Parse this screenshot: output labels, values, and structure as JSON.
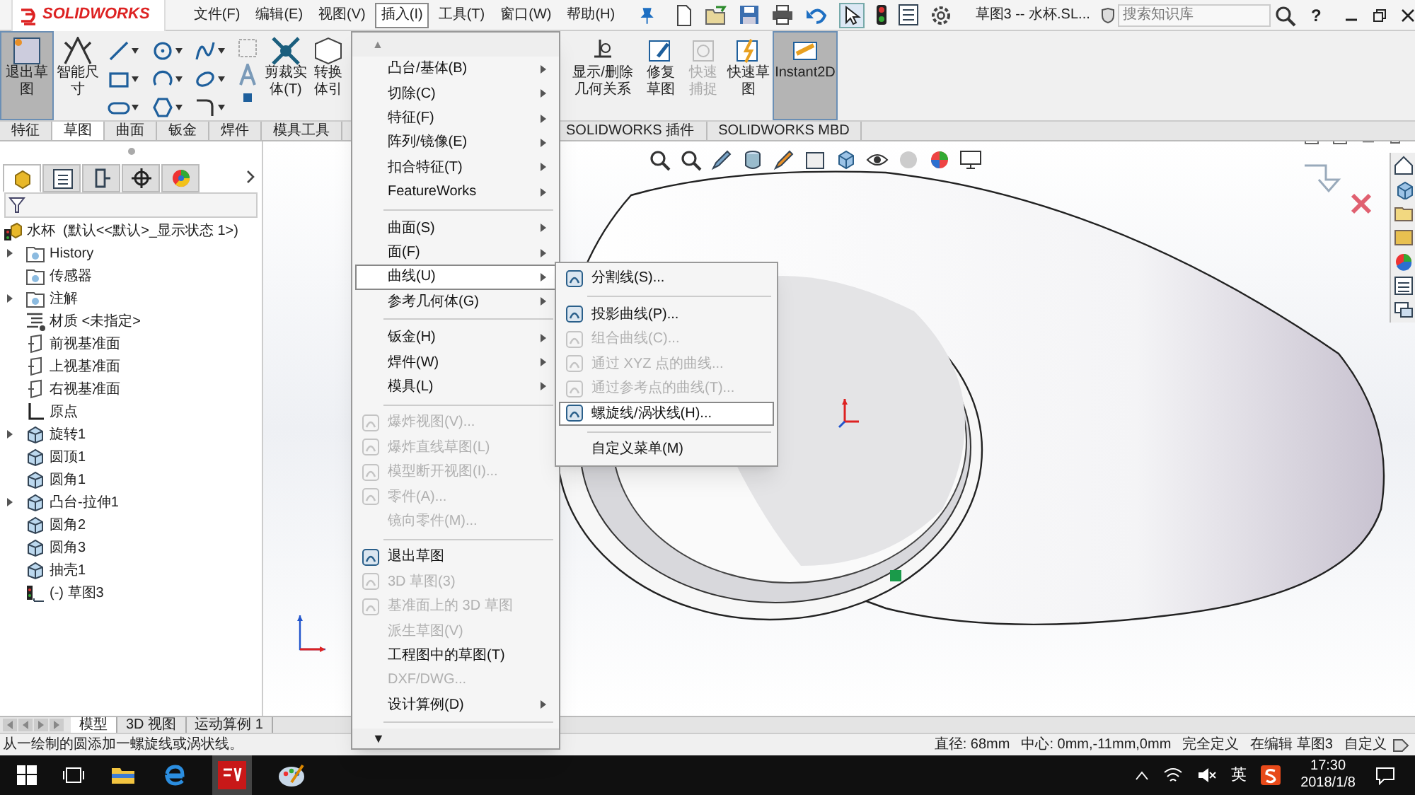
{
  "app": {
    "logo": "SOLIDWORKS",
    "title": "草图3 -- 水杯.SL..."
  },
  "menubar": [
    {
      "label": "文件(F)",
      "selected": false
    },
    {
      "label": "编辑(E)",
      "selected": false
    },
    {
      "label": "视图(V)",
      "selected": false
    },
    {
      "label": "插入(I)",
      "selected": true
    },
    {
      "label": "工具(T)",
      "selected": false
    },
    {
      "label": "窗口(W)",
      "selected": false
    },
    {
      "label": "帮助(H)",
      "selected": false
    }
  ],
  "search": {
    "placeholder": "搜索知识库"
  },
  "help": "?",
  "ribbon_left": [
    {
      "label": "退出草图",
      "selected": true,
      "disabled": false
    },
    {
      "label": "智能尺寸",
      "selected": false,
      "disabled": false
    },
    {
      "label": "剪裁实体(T)",
      "selected": false,
      "disabled": false
    },
    {
      "label": "转换体引",
      "selected": false,
      "disabled": false
    }
  ],
  "ribbon_right": [
    {
      "label": "显示/删除几何关系",
      "selected": false,
      "disabled": false
    },
    {
      "label": "修复草图",
      "selected": false,
      "disabled": false
    },
    {
      "label": "快速捕捉",
      "selected": false,
      "disabled": true
    },
    {
      "label": "快速草图",
      "selected": false,
      "disabled": false
    },
    {
      "label": "Instant2D",
      "selected": true,
      "disabled": false
    }
  ],
  "command_tabs_left": [
    {
      "label": "特征",
      "selected": false
    },
    {
      "label": "草图",
      "selected": true
    },
    {
      "label": "曲面",
      "selected": false
    },
    {
      "label": "钣金",
      "selected": false
    },
    {
      "label": "焊件",
      "selected": false
    },
    {
      "label": "模具工具",
      "selected": false
    }
  ],
  "command_tabs_right": [
    {
      "label": "SOLIDWORKS 插件",
      "selected": false
    },
    {
      "label": "SOLIDWORKS MBD",
      "selected": false
    }
  ],
  "panel_tabs": [
    {
      "selected": true
    },
    {
      "selected": false
    },
    {
      "selected": false
    },
    {
      "selected": false
    },
    {
      "selected": false
    }
  ],
  "tree": {
    "root": "水杯  (默认<<默认>_显示状态 1>)",
    "items": [
      {
        "label": "History",
        "kind": "folder",
        "expandable": true
      },
      {
        "label": "传感器",
        "kind": "folder",
        "expandable": false
      },
      {
        "label": "注解",
        "kind": "folder",
        "expandable": true
      },
      {
        "label": "材质 <未指定>",
        "kind": "material",
        "expandable": false
      },
      {
        "label": "前视基准面",
        "kind": "plane",
        "expandable": false
      },
      {
        "label": "上视基准面",
        "kind": "plane",
        "expandable": false
      },
      {
        "label": "右视基准面",
        "kind": "plane",
        "expandable": false
      },
      {
        "label": "原点",
        "kind": "origin",
        "expandable": false
      },
      {
        "label": "旋转1",
        "kind": "feature",
        "expandable": true
      },
      {
        "label": "圆顶1",
        "kind": "feature",
        "expandable": false
      },
      {
        "label": "圆角1",
        "kind": "feature",
        "expandable": false
      },
      {
        "label": "凸台-拉伸1",
        "kind": "feature",
        "expandable": true
      },
      {
        "label": "圆角2",
        "kind": "feature",
        "expandable": false
      },
      {
        "label": "圆角3",
        "kind": "feature",
        "expandable": false
      },
      {
        "label": "抽壳1",
        "kind": "feature",
        "expandable": false
      },
      {
        "label": "(-) 草图3",
        "kind": "sketch",
        "expandable": false
      }
    ]
  },
  "menu": {
    "scroll_up": "▲",
    "scroll_down": "▼",
    "items": [
      {
        "kind": "item",
        "label": "凸台/基体(B)",
        "submenu": true,
        "disabled": false,
        "selected": false
      },
      {
        "kind": "item",
        "label": "切除(C)",
        "submenu": true,
        "disabled": false,
        "selected": false
      },
      {
        "kind": "item",
        "label": "特征(F)",
        "submenu": true,
        "disabled": false,
        "selected": false
      },
      {
        "kind": "item",
        "label": "阵列/镜像(E)",
        "submenu": true,
        "disabled": false,
        "selected": false
      },
      {
        "kind": "item",
        "label": "扣合特征(T)",
        "submenu": true,
        "disabled": false,
        "selected": false
      },
      {
        "kind": "item",
        "label": "FeatureWorks",
        "submenu": true,
        "disabled": false,
        "selected": false
      },
      {
        "kind": "separator"
      },
      {
        "kind": "item",
        "label": "曲面(S)",
        "submenu": true,
        "disabled": false,
        "selected": false
      },
      {
        "kind": "item",
        "label": "面(F)",
        "submenu": true,
        "disabled": false,
        "selected": false
      },
      {
        "kind": "item",
        "label": "曲线(U)",
        "submenu": true,
        "disabled": false,
        "selected": true
      },
      {
        "kind": "item",
        "label": "参考几何体(G)",
        "submenu": true,
        "disabled": false,
        "selected": false
      },
      {
        "kind": "separator"
      },
      {
        "kind": "item",
        "label": "钣金(H)",
        "submenu": true,
        "disabled": false,
        "selected": false
      },
      {
        "kind": "item",
        "label": "焊件(W)",
        "submenu": true,
        "disabled": false,
        "selected": false
      },
      {
        "kind": "item",
        "label": "模具(L)",
        "submenu": true,
        "disabled": false,
        "selected": false
      },
      {
        "kind": "separator"
      },
      {
        "kind": "icon_item",
        "label": "爆炸视图(V)...",
        "submenu": false,
        "disabled": true,
        "selected": false
      },
      {
        "kind": "icon_item",
        "label": "爆炸直线草图(L)",
        "submenu": false,
        "disabled": true,
        "selected": false
      },
      {
        "kind": "icon_item",
        "label": "模型断开视图(I)...",
        "submenu": false,
        "disabled": true,
        "selected": false
      },
      {
        "kind": "icon_item",
        "label": "零件(A)...",
        "submenu": false,
        "disabled": true,
        "selected": false
      },
      {
        "kind": "item",
        "label": "镜向零件(M)...",
        "submenu": false,
        "disabled": true,
        "selected": false
      },
      {
        "kind": "separator"
      },
      {
        "kind": "icon_item",
        "label": "退出草图",
        "submenu": false,
        "disabled": false,
        "selected": false
      },
      {
        "kind": "icon_item",
        "label": "3D 草图(3)",
        "submenu": false,
        "disabled": true,
        "selected": false
      },
      {
        "kind": "icon_item",
        "label": "基准面上的 3D 草图",
        "submenu": false,
        "disabled": true,
        "selected": false
      },
      {
        "kind": "item",
        "label": "派生草图(V)",
        "submenu": false,
        "disabled": true,
        "selected": false
      },
      {
        "kind": "item",
        "label": "工程图中的草图(T)",
        "submenu": false,
        "disabled": false,
        "selected": false
      },
      {
        "kind": "item",
        "label": "DXF/DWG...",
        "submenu": false,
        "disabled": true,
        "selected": false
      },
      {
        "kind": "item",
        "label": "设计算例(D)",
        "submenu": true,
        "disabled": false,
        "selected": false
      },
      {
        "kind": "separator"
      }
    ]
  },
  "submenu": {
    "items": [
      {
        "kind": "icon_item",
        "label": "分割线(S)...",
        "disabled": false,
        "selected": false
      },
      {
        "kind": "separator"
      },
      {
        "kind": "icon_item",
        "label": "投影曲线(P)...",
        "disabled": false,
        "selected": false
      },
      {
        "kind": "icon_item",
        "label": "组合曲线(C)...",
        "disabled": true,
        "selected": false
      },
      {
        "kind": "icon_item",
        "label": "通过 XYZ 点的曲线...",
        "disabled": true,
        "selected": false
      },
      {
        "kind": "icon_item",
        "label": "通过参考点的曲线(T)...",
        "disabled": true,
        "selected": false
      },
      {
        "kind": "icon_item",
        "label": "螺旋线/涡状线(H)...",
        "disabled": false,
        "selected": true
      },
      {
        "kind": "separator"
      },
      {
        "kind": "item",
        "label": "自定义菜单(M)",
        "disabled": false,
        "selected": false
      }
    ]
  },
  "bottom_tabs": [
    {
      "label": "模型",
      "selected": true
    },
    {
      "label": "3D 视图",
      "selected": false
    },
    {
      "label": "运动算例 1",
      "selected": false
    }
  ],
  "status": {
    "message": "从一绘制的圆添加一螺旋线或涡状线。",
    "fields": [
      "直径: 68mm",
      "中心: 0mm,-11mm,0mm",
      "完全定义",
      "在编辑 草图3",
      "自定义"
    ]
  },
  "taskbar": {
    "ime": "英",
    "time": "17:30",
    "date": "2018/1/8"
  }
}
